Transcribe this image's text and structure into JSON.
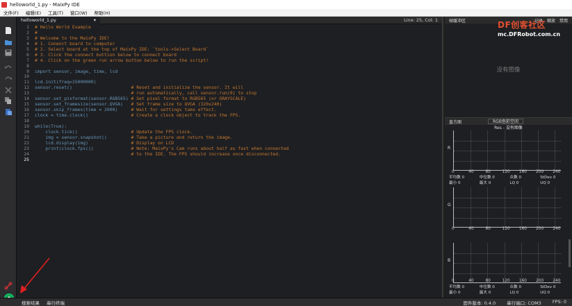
{
  "window": {
    "title": "helloworld_1.py - MaixPy IDE"
  },
  "menu": [
    "文件(F)",
    "编辑(E)",
    "工具(T)",
    "窗口(W)",
    "帮助(H)"
  ],
  "editor": {
    "tab_label": "helloworld_1.py",
    "tab_dropdown": "▾",
    "tab_close": "×",
    "cursor_pos": "Line: 25, Col: 1",
    "current_line": 25,
    "lines": [
      {
        "n": "1",
        "text": "# Hello World Example",
        "cls": "cmt"
      },
      {
        "n": "2",
        "text": "#",
        "cls": "cmt"
      },
      {
        "n": "3",
        "text": "# Welcome to the MaixPy IDE!",
        "cls": "cmt"
      },
      {
        "n": "4",
        "text": "# 1. Conenct board to computer",
        "cls": "cmt"
      },
      {
        "n": "5",
        "text": "# 2. Select board at the top of MaixPy IDE: `tools->Select Board`",
        "cls": "cmt"
      },
      {
        "n": "6",
        "text": "# 3. Click the connect buttion below to connect board",
        "cls": "cmt"
      },
      {
        "n": "7",
        "text": "# 4. Click on the green run arrow button below to run the script!",
        "cls": "cmt"
      },
      {
        "n": "8",
        "text": "",
        "cls": "cd"
      },
      {
        "n": "9",
        "text": "import sensor, image, time, lcd",
        "cls": "kw"
      },
      {
        "n": "10",
        "text": "",
        "cls": "cd"
      },
      {
        "n": "11",
        "code": "lcd.init(freq=15000000)",
        "comment": "",
        "cls": "cd"
      },
      {
        "n": "12",
        "code": "sensor.reset()                      ",
        "comment": "# Reset and initialize the sensor. It will",
        "cls": "cd"
      },
      {
        "n": "13",
        "code": "                                    ",
        "comment": "# run automatically, call sensor.run(0) to stop",
        "cls": "cd"
      },
      {
        "n": "14",
        "code": "sensor.set_pixformat(sensor.RGB565) ",
        "comment": "# Set pixel format to RGB565 (or GRAYSCALE)",
        "cls": "cd"
      },
      {
        "n": "15",
        "code": "sensor.set_framesize(sensor.QVGA)   ",
        "comment": "# Set frame size to QVGA (320x240)",
        "cls": "cd"
      },
      {
        "n": "16",
        "code": "sensor.skip_frames(time = 2000)     ",
        "comment": "# Wait for settings take effect.",
        "cls": "cd"
      },
      {
        "n": "17",
        "code": "clock = time.clock()                ",
        "comment": "# Create a clock object to track the FPS.",
        "cls": "cd"
      },
      {
        "n": "18",
        "text": "",
        "cls": "cd"
      },
      {
        "n": "19",
        "code": "while(True):",
        "comment": "",
        "cls": "kw"
      },
      {
        "n": "20",
        "code": "    clock.tick()                    ",
        "comment": "# Update the FPS clock.",
        "cls": "cd"
      },
      {
        "n": "21",
        "code": "    img = sensor.snapshot()         ",
        "comment": "# Take a picture and return the image.",
        "cls": "cd"
      },
      {
        "n": "22",
        "code": "    lcd.display(img)                ",
        "comment": "# Display on LCD",
        "cls": "cd"
      },
      {
        "n": "23",
        "code": "    print(clock.fps())              ",
        "comment": "# Note: MaixPy's Cam runs about half as fast when connected",
        "cls": "cd"
      },
      {
        "n": "24",
        "code": "                                    ",
        "comment": "# to the IDE. The FPS should increase once disconnected.",
        "cls": "cd"
      },
      {
        "n": "25",
        "text": "",
        "cls": "cd"
      }
    ]
  },
  "framebuffer": {
    "header_left": "帧缓冲区",
    "header_record": "记录",
    "header_zoom": "缩放",
    "header_disable": "禁用",
    "no_image": "没有图像",
    "watermark_logo": "DF创客社区",
    "watermark_url": "mc.DFRobot.com.cn"
  },
  "histogram": {
    "title": "直方图",
    "colorspace": "RGB色彩空间",
    "subtitle": "Res - 没有图像",
    "ticks": [
      "0",
      "40",
      "80",
      "120",
      "160",
      "200",
      "240"
    ],
    "channels": [
      "R",
      "G",
      "B"
    ],
    "stats_row1": [
      "平均数 0",
      "中位数 0",
      "众数 0",
      "StDev 0"
    ],
    "stats_row2": [
      "最小 0",
      "最大 0",
      "LQ 0",
      "UQ 0"
    ]
  },
  "bottom": {
    "search_results": "搜索结果",
    "serial_terminal": "串行终端",
    "firmware": "固件版本: 0.4.0",
    "serial_port": "串行端口: COM3",
    "fps": "FPS: 0"
  },
  "colors": {
    "run_button": "#18a35a",
    "comment": "#c77830",
    "code": "#6897bb",
    "annotation_arrow": "#e02020"
  }
}
